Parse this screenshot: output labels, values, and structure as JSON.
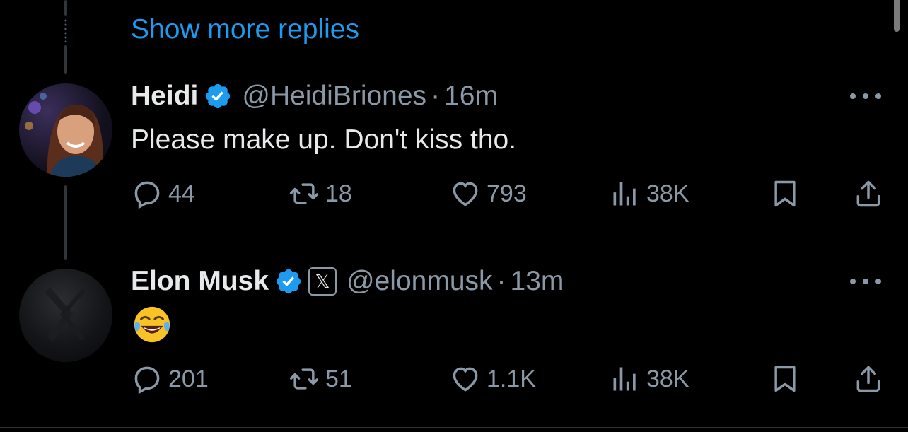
{
  "thread": {
    "show_more_label": "Show more replies"
  },
  "tweets": [
    {
      "name": "Heidi",
      "handle": "@HeidiBriones",
      "separator": "·",
      "time": "16m",
      "text": "Please make up. Don't kiss tho.",
      "replies": "44",
      "reposts": "18",
      "likes": "793",
      "views": "38K"
    },
    {
      "name": "Elon Musk",
      "handle": "@elonmusk",
      "separator": "·",
      "time": "13m",
      "text": "",
      "emoji": "face-with-tears-of-joy",
      "affiliation_badge": "𝕏",
      "replies": "201",
      "reposts": "51",
      "likes": "1.1K",
      "views": "38K"
    }
  ],
  "colors": {
    "background": "#000000",
    "accent": "#1d9bf0",
    "text_primary": "#e7e9ea",
    "text_secondary": "#8b98a5",
    "verified": "#1d9bf0"
  },
  "icons": [
    "verified-badge-icon",
    "x-affiliation-icon",
    "more-icon",
    "reply-icon",
    "repost-icon",
    "like-icon",
    "views-icon",
    "bookmark-icon",
    "share-icon"
  ]
}
